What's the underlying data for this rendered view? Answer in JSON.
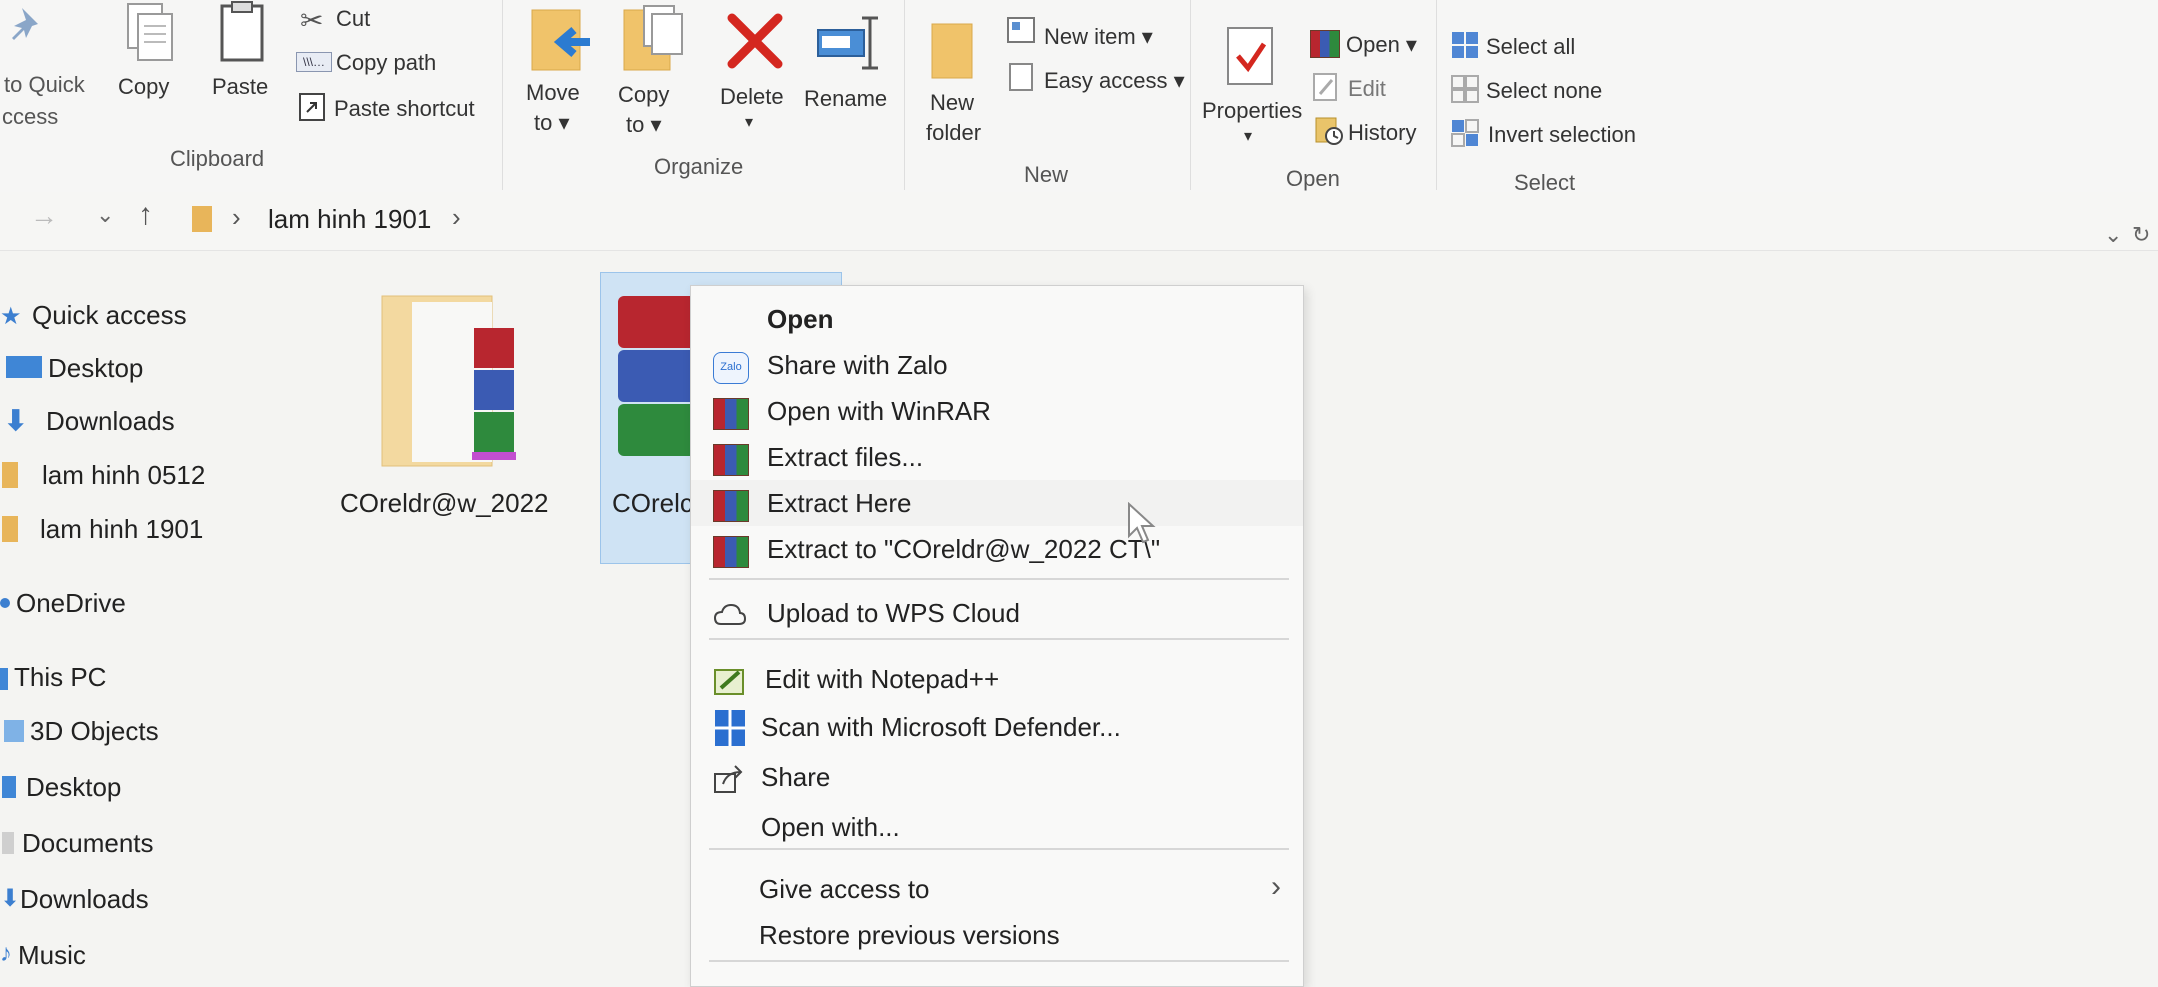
{
  "ribbon": {
    "clipboard": {
      "pin_label_1": "to Quick",
      "pin_label_2": "ccess",
      "copy": "Copy",
      "paste": "Paste",
      "cut": "Cut",
      "copy_path": "Copy path",
      "paste_shortcut": "Paste shortcut",
      "group": "Clipboard"
    },
    "organize": {
      "move_to_1": "Move",
      "move_to_2": "to ▾",
      "copy_to_1": "Copy",
      "copy_to_2": "to ▾",
      "delete": "Delete",
      "delete_arrow": "▾",
      "rename": "Rename",
      "group": "Organize"
    },
    "new": {
      "new_folder_1": "New",
      "new_folder_2": "folder",
      "new_item": "New item ▾",
      "easy_access": "Easy access ▾",
      "group": "New"
    },
    "open": {
      "properties": "Properties",
      "properties_arrow": "▾",
      "open": "Open ▾",
      "edit": "Edit",
      "history": "History",
      "group": "Open"
    },
    "select": {
      "select_all": "Select all",
      "select_none": "Select none",
      "invert_selection": "Invert selection",
      "group": "Select"
    }
  },
  "address": {
    "path_item": "lam hinh 1901",
    "back_icon": "arrow-right",
    "chevron": "›"
  },
  "nav": [
    {
      "label": "Quick access",
      "icon": "star-icon"
    },
    {
      "label": "Desktop",
      "icon": "desktop-icon"
    },
    {
      "label": "Downloads",
      "icon": "download-icon"
    },
    {
      "label": "lam hinh 0512",
      "icon": "folder-icon"
    },
    {
      "label": "lam hinh 1901",
      "icon": "folder-icon"
    },
    {
      "label": "OneDrive",
      "icon": "cloud-icon"
    },
    {
      "label": "This PC",
      "icon": "pc-icon"
    },
    {
      "label": "3D Objects",
      "icon": "cube-icon"
    },
    {
      "label": "Desktop",
      "icon": "desktop-icon"
    },
    {
      "label": "Documents",
      "icon": "document-icon"
    },
    {
      "label": "Downloads",
      "icon": "download-icon"
    },
    {
      "label": "Music",
      "icon": "music-icon"
    }
  ],
  "files": [
    {
      "label": "COreldr@w_2022"
    },
    {
      "label": "COrelc"
    }
  ],
  "context_menu": {
    "open": "Open",
    "share_zalo": "Share with Zalo",
    "zalo_badge": "Zalo",
    "open_winrar": "Open with WinRAR",
    "extract_files": "Extract files...",
    "extract_here": "Extract Here",
    "extract_to": "Extract to \"COreldr@w_2022 CT\\\"",
    "upload_wps": "Upload to WPS Cloud",
    "edit_notepad": "Edit with Notepad++",
    "scan_defender": "Scan with Microsoft Defender...",
    "share": "Share",
    "open_with": "Open with...",
    "give_access": "Give access to",
    "restore_versions": "Restore previous versions"
  }
}
